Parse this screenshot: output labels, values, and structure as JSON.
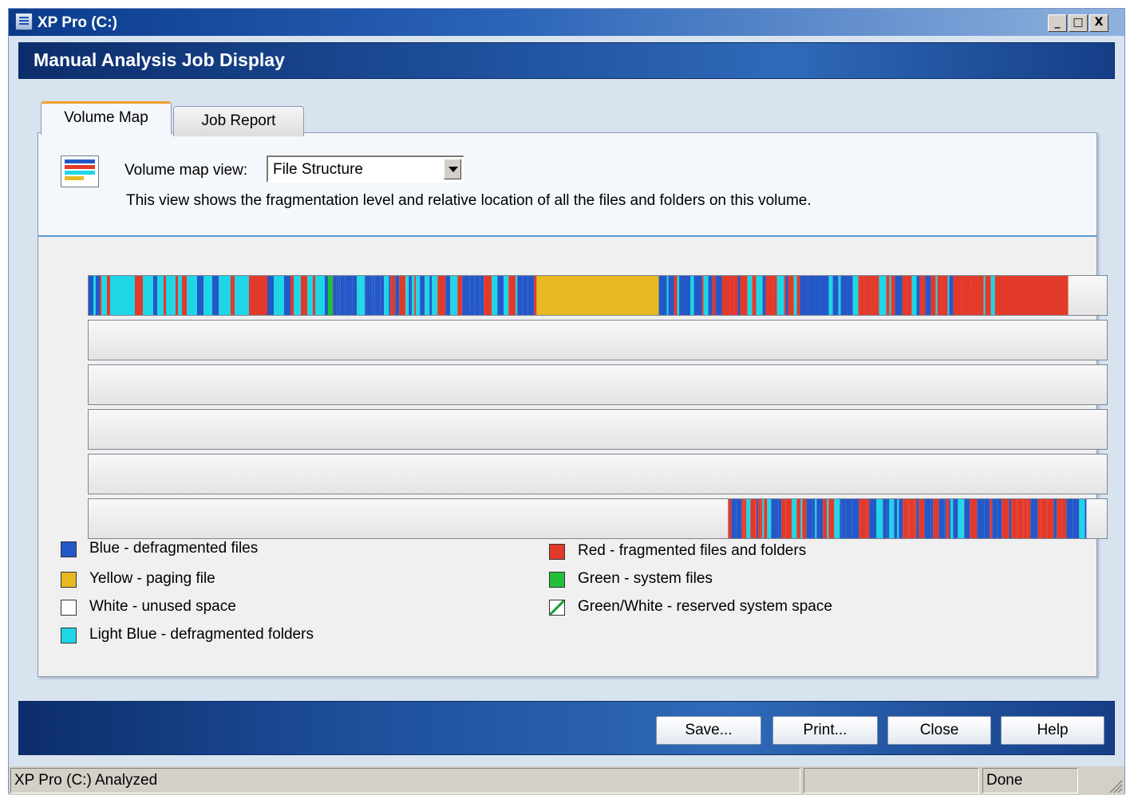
{
  "window": {
    "title": "XP Pro (C:)"
  },
  "window_controls": {
    "minimize": "_",
    "maximize": "□",
    "close": "X"
  },
  "header": {
    "title": "Manual Analysis Job Display"
  },
  "tabs": [
    {
      "label": "Volume Map",
      "active": true
    },
    {
      "label": "Job Report",
      "active": false
    }
  ],
  "view": {
    "label": "Volume map view:",
    "selected": "File Structure",
    "description": "This view shows the fragmentation level and relative location of all the files and folders on this volume."
  },
  "colors": {
    "blue": "#2457c8",
    "red": "#e23a2a",
    "yellow": "#e8b820",
    "light_blue": "#1ed6e6",
    "green": "#22c03a",
    "white": "#ffffff",
    "accent": "#5a9bd5"
  },
  "volume_map": {
    "row_count": 6,
    "row1_fraction_used": 0.962,
    "row6_start_fraction": 0.628,
    "row6_end_fraction": 0.98
  },
  "legend": [
    {
      "label": "Blue - defragmented files",
      "color": "#2457c8"
    },
    {
      "label": "Yellow - paging file",
      "color": "#e8b820"
    },
    {
      "label": "White - unused space",
      "color": "#ffffff"
    },
    {
      "label": "Light Blue - defragmented folders",
      "color": "#1ed6e6"
    },
    {
      "label": "Red - fragmented files and folders",
      "color": "#e23a2a"
    },
    {
      "label": "Green - system files",
      "color": "#22c03a"
    },
    {
      "label": "Green/White - reserved system space",
      "color": "hatched"
    }
  ],
  "buttons": {
    "save": "Save...",
    "print": "Print...",
    "close": "Close",
    "help": "Help"
  },
  "status": {
    "main": "XP Pro (C:) Analyzed",
    "middle": "",
    "right": "Done"
  }
}
